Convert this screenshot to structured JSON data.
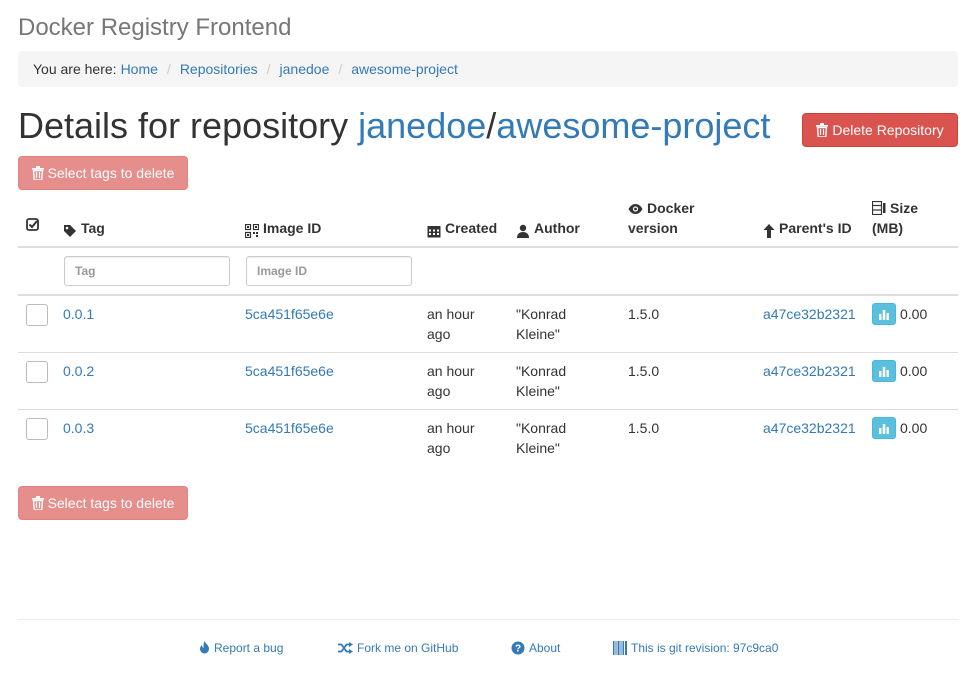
{
  "app": {
    "title": "Docker Registry Frontend"
  },
  "breadcrumb": {
    "prefix": "You are here:",
    "items": [
      "Home",
      "Repositories",
      "janedoe",
      "awesome-project"
    ]
  },
  "heading": {
    "prefix": "Details for repository",
    "user": "janedoe",
    "separator": "/",
    "repo": "awesome-project"
  },
  "buttons": {
    "delete_repository": "Delete Repository",
    "select_tags": "Select tags to delete"
  },
  "table": {
    "headers": {
      "tag": "Tag",
      "image_id": "Image ID",
      "created": "Created",
      "author": "Author",
      "docker_version_l1": "Docker",
      "docker_version_l2": "version",
      "parent_id": "Parent's ID",
      "size_l1": "Size",
      "size_l2": "(MB)"
    },
    "filters": {
      "tag_placeholder": "Tag",
      "image_id_placeholder": "Image ID"
    },
    "rows": [
      {
        "tag": "0.0.1",
        "image_id": "5ca451f65e6e",
        "created_l1": "an hour",
        "created_l2": "ago",
        "author_l1": "\"Konrad",
        "author_l2": "Kleine\"",
        "docker_version": "1.5.0",
        "parent_id": "a47ce32b2321",
        "size": "0.00"
      },
      {
        "tag": "0.0.2",
        "image_id": "5ca451f65e6e",
        "created_l1": "an hour",
        "created_l2": "ago",
        "author_l1": "\"Konrad",
        "author_l2": "Kleine\"",
        "docker_version": "1.5.0",
        "parent_id": "a47ce32b2321",
        "size": "0.00"
      },
      {
        "tag": "0.0.3",
        "image_id": "5ca451f65e6e",
        "created_l1": "an hour",
        "created_l2": "ago",
        "author_l1": "\"Konrad",
        "author_l2": "Kleine\"",
        "docker_version": "1.5.0",
        "parent_id": "a47ce32b2321",
        "size": "0.00"
      }
    ]
  },
  "footer": {
    "report_bug": "Report a bug",
    "fork_github": "Fork me on GitHub",
    "about": "About",
    "git_revision": "This is git revision: 97c9ca0"
  },
  "colors": {
    "link": "#337ab7",
    "danger": "#d9534f",
    "info": "#5bc0de"
  },
  "icons": [
    "trash-icon",
    "check-square-icon",
    "tag-icon",
    "qrcode-icon",
    "calendar-icon",
    "user-icon",
    "eye-icon",
    "arrow-up-icon",
    "database-icon",
    "bar-chart-icon",
    "fire-icon",
    "random-icon",
    "question-sign-icon",
    "barcode-icon"
  ]
}
